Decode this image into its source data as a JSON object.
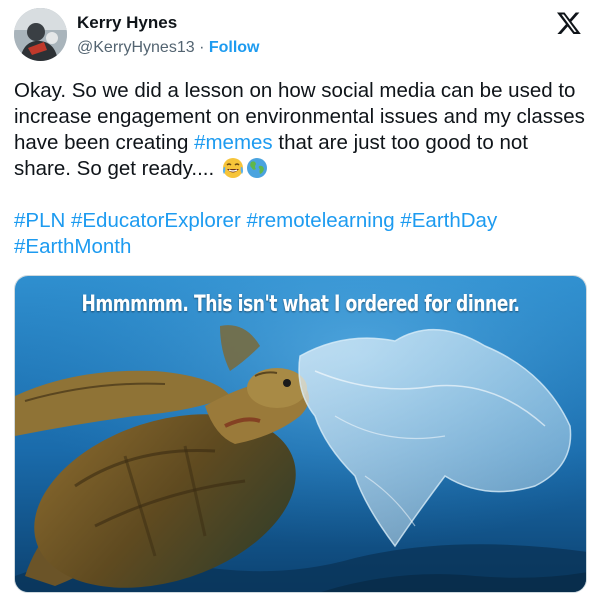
{
  "author": {
    "display_name": "Kerry Hynes",
    "handle": "@KerryHynes13",
    "separator": " · ",
    "follow_label": "Follow",
    "avatar_icon": "avatar-photo"
  },
  "platform": {
    "logo_icon": "x-logo-icon"
  },
  "tweet": {
    "text_main": "Okay. So we did a lesson on how social media can be used to increase engagement on environmental issues and my classes have been creating ",
    "inline_hashtag": "#memes",
    "text_after_hashtag": " that are just too good to not share. So get ready.... ",
    "emojis": [
      "tears-of-joy-emoji",
      "globe-emoji"
    ],
    "hashtags": [
      "#PLN",
      "#EducatorExplorer",
      "#remotelearning",
      "#EarthDay",
      "#EarthMonth"
    ]
  },
  "media": {
    "caption": "Hmmmmm. This isn't what I ordered for dinner.",
    "scene": "sea-turtle-plastic-bag"
  },
  "colors": {
    "link": "#1d9bf0",
    "text": "#0f1419",
    "secondary_text": "#536471",
    "ocean_deep": "#0d4f86",
    "ocean_light": "#2f8fcf"
  }
}
